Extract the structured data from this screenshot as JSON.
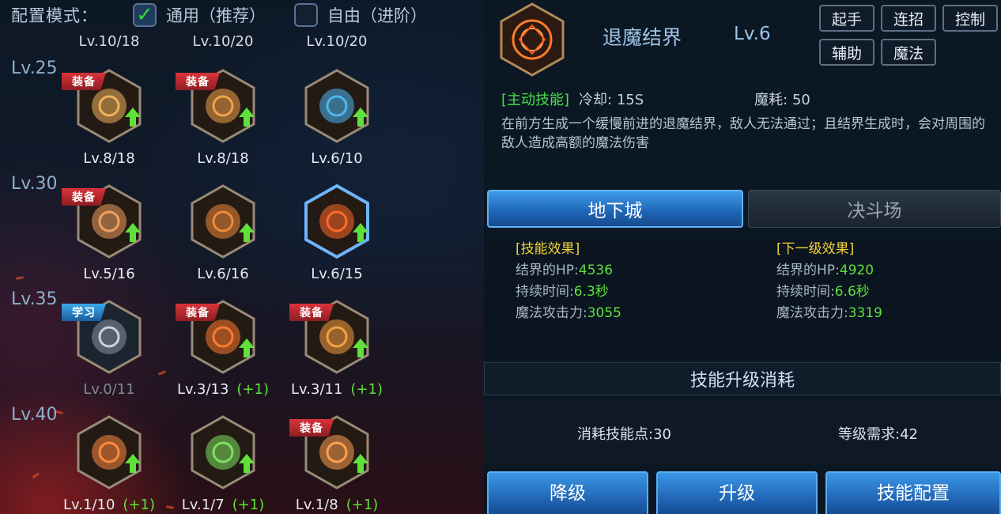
{
  "config": {
    "label": "配置模式：",
    "option_general": "通用（推荐）",
    "option_free": "自由（进阶）"
  },
  "top_levels": [
    "Lv.10/18",
    "Lv.10/20",
    "Lv.10/20"
  ],
  "tiers": [
    {
      "label": "Lv.25",
      "skills": [
        {
          "level": "Lv.8/18",
          "badge": "装备",
          "badge_type": "equip",
          "upgrade": true,
          "icon": "shield-skill-icon",
          "bonus": ""
        },
        {
          "level": "Lv.8/18",
          "badge": "装备",
          "badge_type": "equip",
          "upgrade": true,
          "icon": "cross-skill-icon",
          "bonus": ""
        },
        {
          "level": "Lv.6/10",
          "badge": "",
          "badge_type": "",
          "upgrade": true,
          "icon": "figure-skill-icon",
          "bonus": ""
        }
      ]
    },
    {
      "label": "Lv.30",
      "skills": [
        {
          "level": "Lv.5/16",
          "badge": "装备",
          "badge_type": "equip",
          "upgrade": true,
          "icon": "muscle-skill-icon",
          "bonus": ""
        },
        {
          "level": "Lv.6/16",
          "badge": "",
          "badge_type": "",
          "upgrade": true,
          "icon": "whirlwind-skill-icon",
          "bonus": ""
        },
        {
          "level": "Lv.6/15",
          "badge": "",
          "badge_type": "",
          "upgrade": true,
          "icon": "seal-skill-icon",
          "bonus": "",
          "selected": true
        }
      ]
    },
    {
      "label": "Lv.35",
      "skills": [
        {
          "level": "Lv.0/11",
          "badge": "学习",
          "badge_type": "learn",
          "upgrade": false,
          "icon": "wings-skill-icon",
          "bonus": "",
          "dim": true
        },
        {
          "level": "Lv.3/13",
          "badge": "装备",
          "badge_type": "equip",
          "upgrade": true,
          "icon": "burst-skill-icon",
          "bonus": "(+1)"
        },
        {
          "level": "Lv.3/11",
          "badge": "装备",
          "badge_type": "equip",
          "upgrade": true,
          "icon": "sword-skill-icon",
          "bonus": "(+1)"
        }
      ]
    },
    {
      "label": "Lv.40",
      "skills": [
        {
          "level": "Lv.1/10",
          "badge": "",
          "badge_type": "",
          "upgrade": true,
          "icon": "swirl-skill-icon",
          "bonus": "(+1)"
        },
        {
          "level": "Lv.1/7",
          "badge": "",
          "badge_type": "",
          "upgrade": true,
          "icon": "bird-skill-icon",
          "bonus": "(+1)"
        },
        {
          "level": "Lv.1/8",
          "badge": "装备",
          "badge_type": "equip",
          "upgrade": true,
          "icon": "phoenix-skill-icon",
          "bonus": "(+1)"
        }
      ]
    }
  ],
  "detail": {
    "name": "退魔结界",
    "level": "Lv.6",
    "tags": [
      "起手",
      "连招",
      "控制",
      "辅助",
      "魔法"
    ],
    "active_label": "[主动技能]",
    "cooldown": "冷却: 15S",
    "mana": "魔耗: 50",
    "description": "在前方生成一个缓慢前进的退魔结界，敌人无法通过；且结界生成时，会对周围的敌人造成高额的魔法伤害"
  },
  "tabs": [
    "地下城",
    "决斗场"
  ],
  "effects": {
    "current_title": "[技能效果]",
    "next_title": "[下一级效果]",
    "current": [
      {
        "key": "结界的HP:",
        "value": "4536"
      },
      {
        "key": "持续时间:",
        "value": "6.3秒"
      },
      {
        "key": "魔法攻击力:",
        "value": "3055"
      }
    ],
    "next": [
      {
        "key": "结界的HP:",
        "value": "4920"
      },
      {
        "key": "持续时间:",
        "value": "6.6秒"
      },
      {
        "key": "魔法攻击力:",
        "value": "3319"
      }
    ]
  },
  "cost": {
    "title": "技能升级消耗",
    "points": "消耗技能点:30",
    "level_req": "等级需求:42"
  },
  "buttons": {
    "downgrade": "降级",
    "upgrade": "升级",
    "config": "技能配置"
  },
  "colors": {
    "accent_blue": "#1f63b4",
    "equip_badge": "#d9343a",
    "learn_badge": "#3aa8e8",
    "upgrade_green": "#5fe03a",
    "title_yellow": "#f1d33a"
  }
}
